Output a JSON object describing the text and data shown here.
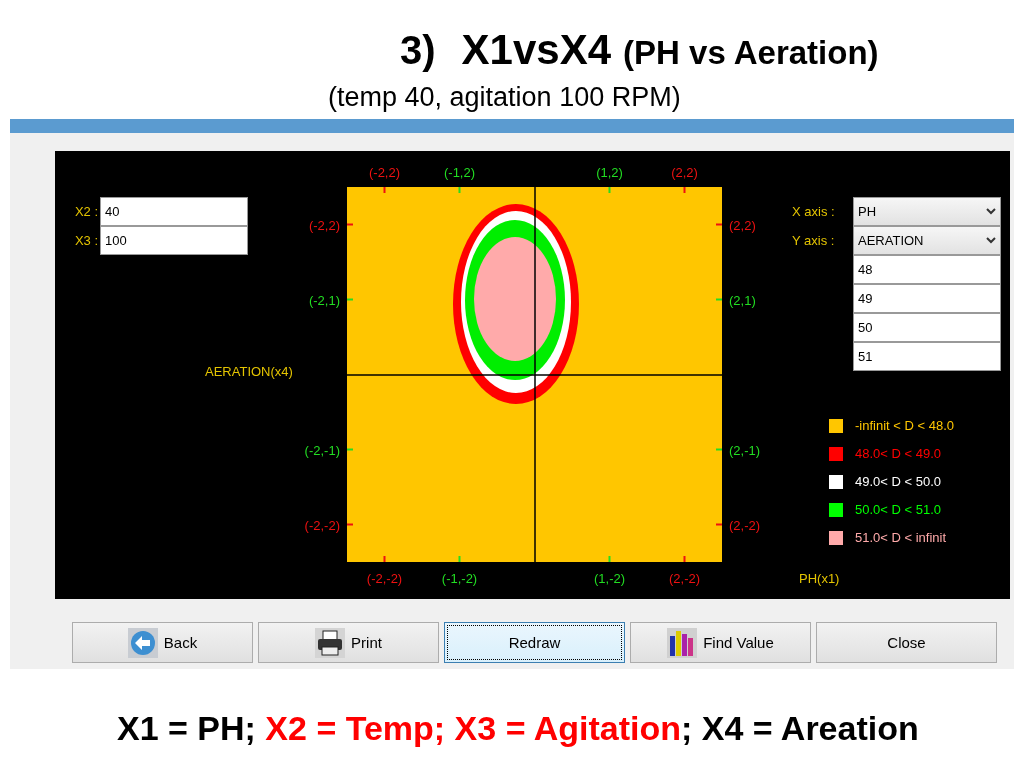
{
  "heading": {
    "number": "3)",
    "title": "X1vsX4",
    "subtitle": "(PH vs Aeration)"
  },
  "conditions": "(temp 40, agitation 100 RPM)",
  "window": {
    "inputs": [
      {
        "label": "X2 :",
        "value": "40"
      },
      {
        "label": "X3 :",
        "value": "100"
      }
    ],
    "axis_selects": [
      {
        "label": "X axis :",
        "value": "PH"
      },
      {
        "label": "Y axis :",
        "value": "AERATION"
      }
    ],
    "levels": [
      "48",
      "49",
      "50",
      "51"
    ],
    "plot": {
      "y_label": "AERATION(x4)",
      "x_label": "PH(x1)",
      "top_ticks": [
        {
          "label": "(-2,2)",
          "color": "#ee1111"
        },
        {
          "label": "(-1,2)",
          "color": "#22dd22"
        },
        {
          "label": "(1,2)",
          "color": "#22dd22"
        },
        {
          "label": "(2,2)",
          "color": "#ee1111"
        }
      ],
      "bottom_ticks": [
        {
          "label": "(-2,-2)",
          "color": "#ee1111"
        },
        {
          "label": "(-1,-2)",
          "color": "#22dd22"
        },
        {
          "label": "(1,-2)",
          "color": "#22dd22"
        },
        {
          "label": "(2,-2)",
          "color": "#ee1111"
        }
      ],
      "left_ticks": [
        {
          "label": "(-2,2)",
          "color": "#ee1111"
        },
        {
          "label": "(-2,1)",
          "color": "#22dd22"
        },
        {
          "label": "(-2,-1)",
          "color": "#22dd22"
        },
        {
          "label": "(-2,-2)",
          "color": "#ee1111"
        }
      ],
      "right_ticks": [
        {
          "label": "(2,2)",
          "color": "#ee1111"
        },
        {
          "label": "(2,1)",
          "color": "#22dd22"
        },
        {
          "label": "(2,-1)",
          "color": "#22dd22"
        },
        {
          "label": "(2,-2)",
          "color": "#ee1111"
        }
      ]
    },
    "legend": [
      {
        "label": "-infinit < D < 48.0",
        "color": "#ffc600"
      },
      {
        "label": "48.0< D < 49.0",
        "color": "#ff0000"
      },
      {
        "label": "49.0< D < 50.0",
        "color": "#ffffff"
      },
      {
        "label": "50.0< D < 51.0",
        "color": "#00ff00"
      },
      {
        "label": "51.0< D < infinit",
        "color": "#ffaaaa"
      }
    ],
    "buttons": [
      {
        "label": "Back",
        "kind": "back",
        "focused": false
      },
      {
        "label": "Print",
        "kind": "print",
        "focused": false
      },
      {
        "label": "Redraw",
        "kind": "plain",
        "focused": true
      },
      {
        "label": "Find Value",
        "kind": "find",
        "focused": false
      },
      {
        "label": "Close",
        "kind": "plain",
        "focused": false
      }
    ]
  },
  "footer": [
    {
      "text": "X1 = PH; ",
      "color": "#000000"
    },
    {
      "text": "X2 = Temp; X3 = Agitation",
      "color": "#ff0000"
    },
    {
      "text": "; X4 = Areation",
      "color": "#000000"
    }
  ]
}
